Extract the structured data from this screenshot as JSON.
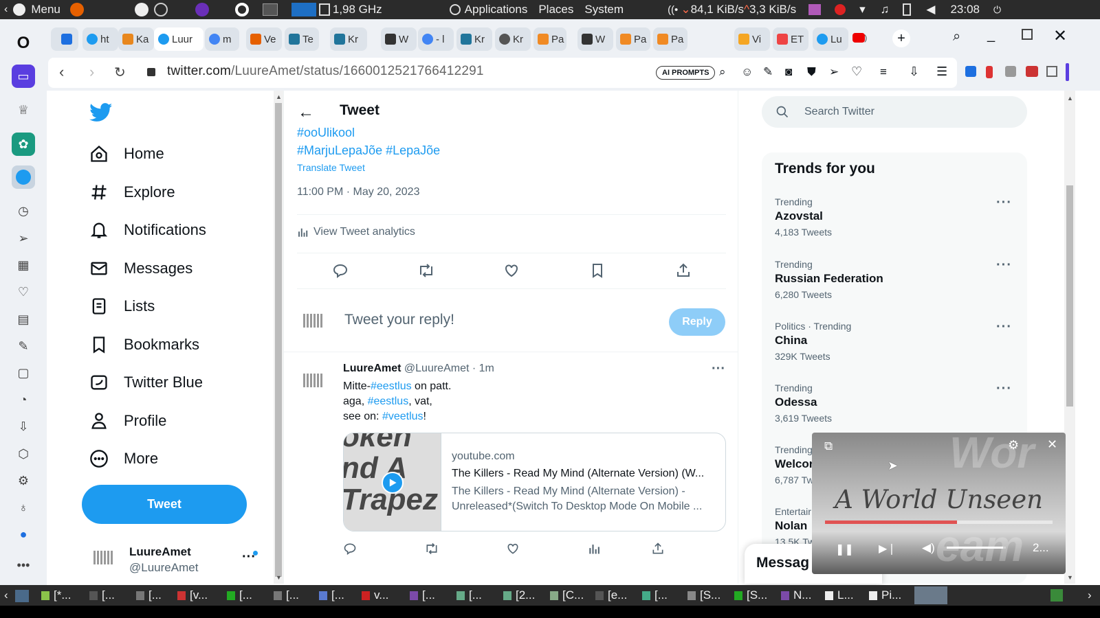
{
  "os_panel": {
    "menu": "Menu",
    "cpu": "1,98 GHz",
    "applications": "Applications",
    "places": "Places",
    "system": "System",
    "net_down": "84,1 KiB/s",
    "net_up": "3,3 KiB/s",
    "clock": "23:08"
  },
  "tabs": [
    {
      "label": "ht",
      "favicon": "twitter"
    },
    {
      "label": "Ka",
      "favicon": "star"
    },
    {
      "label": "Luur",
      "favicon": "twitter",
      "active": true
    },
    {
      "label": "m",
      "favicon": "google"
    },
    {
      "label": "Ve",
      "favicon": "fox"
    },
    {
      "label": "Te",
      "favicon": "wordpress"
    },
    {
      "label": "Kr",
      "favicon": "wordpress"
    },
    {
      "label": "W",
      "favicon": "wikipedia"
    },
    {
      "label": "- l",
      "favicon": "google"
    },
    {
      "label": "Kr",
      "favicon": "wordpress"
    },
    {
      "label": "Kr",
      "favicon": "globe"
    },
    {
      "label": "Pa",
      "favicon": "flame"
    },
    {
      "label": "W",
      "favicon": "wikipedia"
    },
    {
      "label": "Pa",
      "favicon": "flame"
    },
    {
      "label": "Pa",
      "favicon": "flame"
    },
    {
      "label": "Vi",
      "favicon": "video"
    },
    {
      "label": "ET",
      "favicon": "doc"
    },
    {
      "label": "Lu",
      "favicon": "twitter"
    }
  ],
  "address": {
    "domain": "twitter.com",
    "path": "/LuureAmet/status/1660012521766412291",
    "ai_prompts": "AI PROMPTS"
  },
  "nav": {
    "home": "Home",
    "explore": "Explore",
    "notifications": "Notifications",
    "messages": "Messages",
    "lists": "Lists",
    "bookmarks": "Bookmarks",
    "twitter_blue": "Twitter Blue",
    "profile": "Profile",
    "more": "More",
    "tweet_button": "Tweet",
    "account_name": "LuureAmet",
    "account_handle": "@LuureAmet"
  },
  "main": {
    "header": "Tweet",
    "hashtag_partial": "#ooUlikool",
    "hashtags": "#MarjuLepaJõe #LepaJõe",
    "translate": "Translate Tweet",
    "timestamp": "11:00 PM · May 20, 2023",
    "analytics": "View Tweet analytics",
    "reply_placeholder": "Tweet your reply!",
    "reply_button": "Reply"
  },
  "reply_tweet": {
    "name": "LuureAmet",
    "handle": "@LuureAmet",
    "time": "· 1m",
    "line1_a": "Mitte-",
    "line1_tag": "#eestlus",
    "line1_b": " on patt.",
    "line2_a": "aga, ",
    "line2_tag": "#eestlus",
    "line2_b": ", vat,",
    "line3_a": "see on: ",
    "line3_tag": "#veetlus",
    "line3_b": "!",
    "card_domain": "youtube.com",
    "card_title": "The Killers - Read My Mind (Alternate Version) (W...",
    "card_desc": "The Killers - Read My Mind (Alternate Version) - Unreleased*(Switch To Desktop Mode On Mobile ...",
    "thumb_text": "oken\nnd A\nTrapez"
  },
  "right": {
    "search_placeholder": "Search Twitter",
    "trends_title": "Trends for you",
    "trends": [
      {
        "category": "Trending",
        "name": "Azovstal",
        "count": "4,183 Tweets"
      },
      {
        "category": "Trending",
        "name": "Russian Federation",
        "count": "6,280 Tweets"
      },
      {
        "category": "Politics · Trending",
        "name": "China",
        "count": "329K Tweets"
      },
      {
        "category": "Trending",
        "name": "Odessa",
        "count": "3,619 Tweets"
      },
      {
        "category": "Trending",
        "name": "Welcor",
        "count": "6,787 Tw"
      },
      {
        "category": "Entertair",
        "name": "Nolan",
        "count": "13,5K Tw"
      }
    ],
    "messages": "Messag"
  },
  "pip": {
    "title": "A World Unseen",
    "progress": 0.58,
    "volume": 0.95,
    "time": "2..."
  },
  "taskbar": [
    "[*...",
    "[...",
    "[...",
    "[v...",
    "[...",
    "[...",
    "[...",
    "v...",
    "[...",
    "[...",
    "[2...",
    "[C...",
    "[e...",
    "[...",
    "[S...",
    "[S...",
    "N...",
    "L...",
    "Pi..."
  ],
  "colors": {
    "accent": "#1d9bf0",
    "os_panel": "#2b2b2b",
    "pip_progress": "#e05353"
  }
}
